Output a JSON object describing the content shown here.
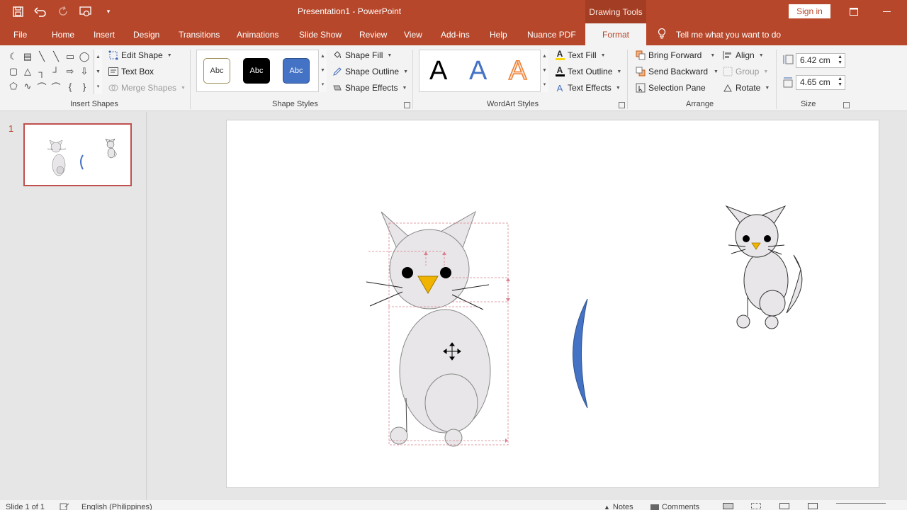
{
  "window": {
    "title": "Presentation1  -  PowerPoint",
    "context_tab_group": "Drawing Tools",
    "sign_in": "Sign in",
    "controls": [
      "restore-icon",
      "minimize-icon"
    ]
  },
  "qat": {
    "icons": [
      "save-icon",
      "undo-icon",
      "redo-icon",
      "start-from-beginning-icon",
      "customize-qat-icon"
    ]
  },
  "tabs": [
    {
      "label": "File"
    },
    {
      "label": "Home"
    },
    {
      "label": "Insert"
    },
    {
      "label": "Design"
    },
    {
      "label": "Transitions"
    },
    {
      "label": "Animations"
    },
    {
      "label": "Slide Show"
    },
    {
      "label": "Review"
    },
    {
      "label": "View"
    },
    {
      "label": "Add-ins"
    },
    {
      "label": "Help"
    },
    {
      "label": "Nuance PDF"
    },
    {
      "label": "Format",
      "active": true
    }
  ],
  "tell_me": "Tell me what you want to do",
  "ribbon": {
    "insert_shapes": {
      "label": "Insert Shapes",
      "edit_shape": "Edit Shape",
      "text_box": "Text Box",
      "merge_shapes": "Merge Shapes"
    },
    "shape_styles": {
      "label": "Shape Styles",
      "swatches": [
        "Abc",
        "Abc",
        "Abc"
      ],
      "shape_fill": "Shape Fill",
      "shape_outline": "Shape Outline",
      "shape_effects": "Shape Effects"
    },
    "wordart_styles": {
      "label": "WordArt Styles",
      "letters": [
        "A",
        "A",
        "A"
      ],
      "text_fill": "Text Fill",
      "text_outline": "Text Outline",
      "text_effects": "Text Effects"
    },
    "arrange": {
      "label": "Arrange",
      "bring_forward": "Bring Forward",
      "send_backward": "Send Backward",
      "selection_pane": "Selection Pane",
      "align": "Align",
      "group": "Group",
      "rotate": "Rotate"
    },
    "size": {
      "label": "Size",
      "height": "6.42 cm",
      "width": "4.65 cm"
    }
  },
  "slides_pane": {
    "slide_number": "1"
  },
  "status": {
    "slide_info": "Slide 1 of 1",
    "language": "English (Philippines)",
    "notes": "Notes",
    "comments": "Comments"
  },
  "colors": {
    "accent": "#b7472a",
    "blue_shape": "#4472c4",
    "cat_fill": "#e8e6e8",
    "beak": "#f0b400"
  }
}
